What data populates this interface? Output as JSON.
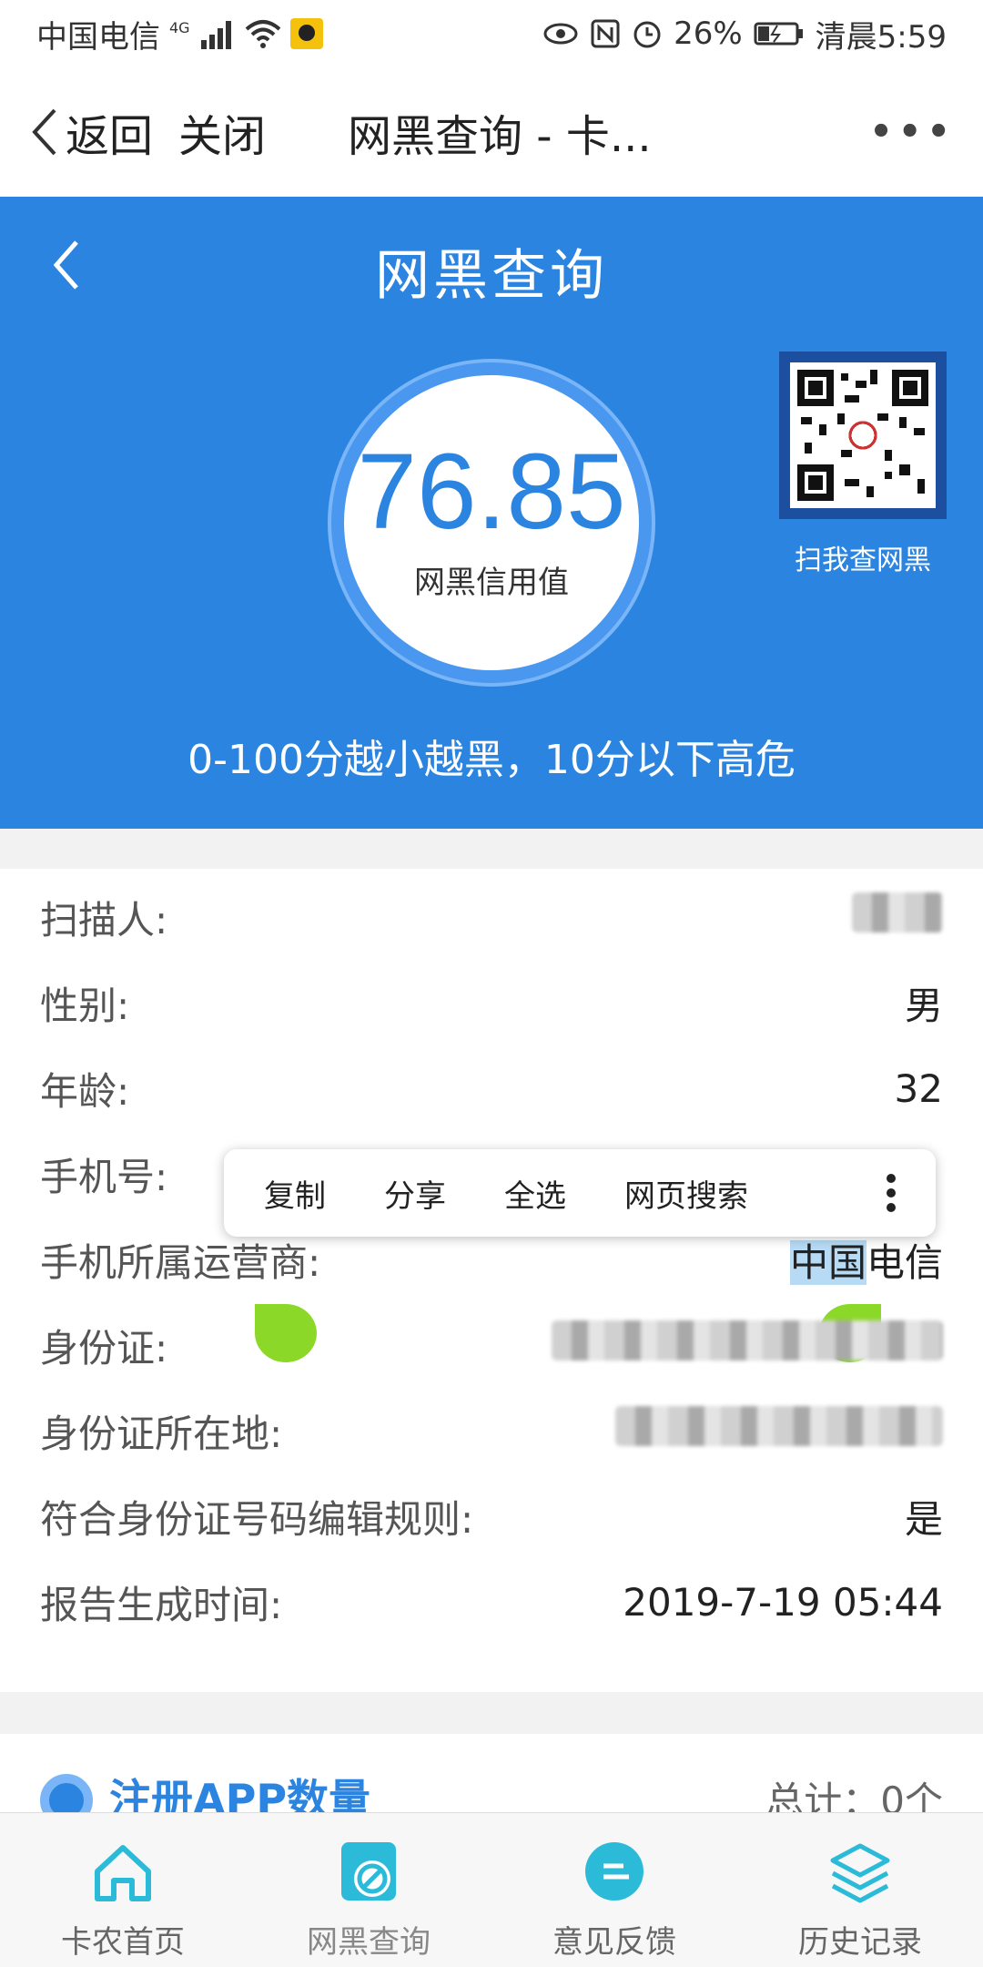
{
  "status_bar": {
    "carrier": "中国电信",
    "network": "4G",
    "battery": "26%",
    "time": "清晨5:59"
  },
  "nav": {
    "back_label": "返回",
    "close_label": "关闭",
    "title": "网黑查询 - 卡...",
    "more_label": "•••"
  },
  "hero": {
    "title": "网黑查询",
    "score": "76.85",
    "score_label": "网黑信用值",
    "qr_label": "扫我查网黑",
    "hint": "0-100分越小越黑，10分以下高危",
    "bg_color": "#2a84e0"
  },
  "info": {
    "rows": [
      {
        "label": "扫描人:",
        "value": ""
      },
      {
        "label": "性别:",
        "value": "男"
      },
      {
        "label": "年龄:",
        "value": "32"
      },
      {
        "label": "手机号:",
        "value": ""
      },
      {
        "label": "手机所属运营商:",
        "value_selected": "中国",
        "value_rest": "电信"
      },
      {
        "label": "身份证:",
        "value": ""
      },
      {
        "label": "身份证所在地:",
        "value": ""
      },
      {
        "label": "符合身份证号码编辑规则:",
        "value": "是"
      },
      {
        "label": "报告生成时间:",
        "value": "2019-7-19 05:44"
      }
    ]
  },
  "context_menu": {
    "items": [
      "复制",
      "分享",
      "全选",
      "网页搜索"
    ]
  },
  "app_count": {
    "title": "注册APP数量",
    "total": "总计：0个"
  },
  "tabs": [
    {
      "label": "卡农首页",
      "icon": "home-icon"
    },
    {
      "label": "网黑查询",
      "icon": "blacklist-query-icon"
    },
    {
      "label": "意见反馈",
      "icon": "feedback-icon"
    },
    {
      "label": "历史记录",
      "icon": "history-layers-icon"
    }
  ]
}
